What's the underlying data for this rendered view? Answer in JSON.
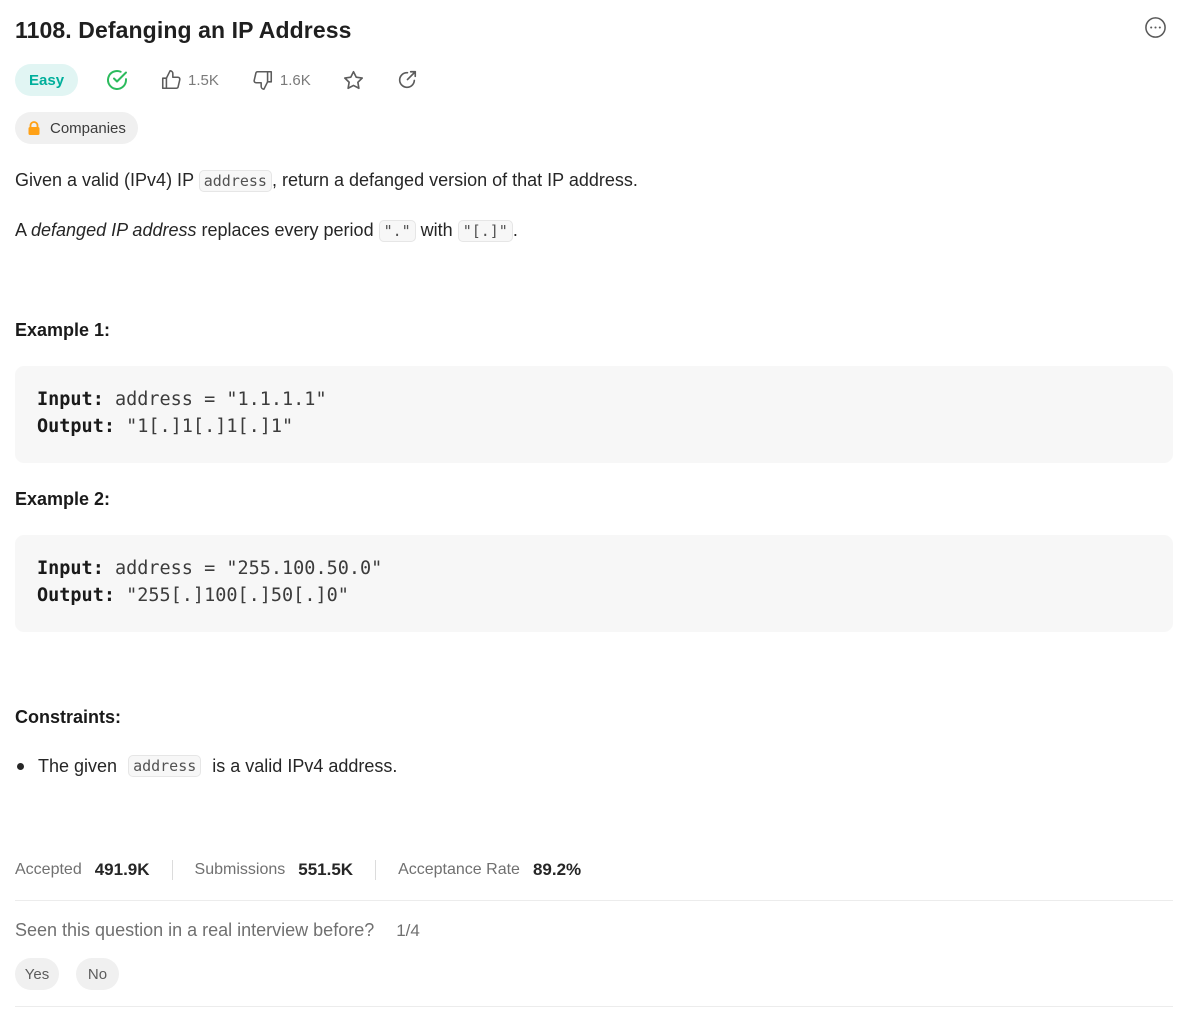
{
  "problem": {
    "title": "1108. Defanging an IP Address",
    "difficulty": "Easy",
    "likes": "1.5K",
    "dislikes": "1.6K",
    "companies_label": "Companies"
  },
  "description": {
    "line1_pre": "Given a valid (IPv4) IP ",
    "line1_code": "address",
    "line1_post": ", return a defanged version of that IP address.",
    "line2_pre": "A ",
    "line2_em": "defanged IP address",
    "line2_mid": " replaces every period ",
    "line2_code1": "\".\"",
    "line2_with": " with ",
    "line2_code2": "\"[.]\"",
    "line2_post": "."
  },
  "examples": [
    {
      "heading": "Example 1:",
      "input_label": "Input:",
      "input_value": " address = \"1.1.1.1\"",
      "output_label": "Output:",
      "output_value": " \"1[.]1[.]1[.]1\""
    },
    {
      "heading": "Example 2:",
      "input_label": "Input:",
      "input_value": " address = \"255.100.50.0\"",
      "output_label": "Output:",
      "output_value": " \"255[.]100[.]50[.]0\""
    }
  ],
  "constraints": {
    "heading": "Constraints:",
    "item_pre": "The given ",
    "item_code": "address",
    "item_post": " is a valid IPv4 address."
  },
  "stats": {
    "accepted_label": "Accepted",
    "accepted_value": "491.9K",
    "submissions_label": "Submissions",
    "submissions_value": "551.5K",
    "rate_label": "Acceptance Rate",
    "rate_value": "89.2%"
  },
  "interview": {
    "question": "Seen this question in a real interview before?",
    "fraction": "1/4",
    "yes": "Yes",
    "no": "No"
  },
  "colors": {
    "easy_text": "#00af9b",
    "easy_bg": "#e1f5f3",
    "solved_check": "#2cbb5d",
    "lock": "#ffa116"
  },
  "icons": [
    "more-icon",
    "solved-check-icon",
    "thumbs-up-icon",
    "thumbs-down-icon",
    "star-icon",
    "share-icon",
    "lock-icon"
  ]
}
